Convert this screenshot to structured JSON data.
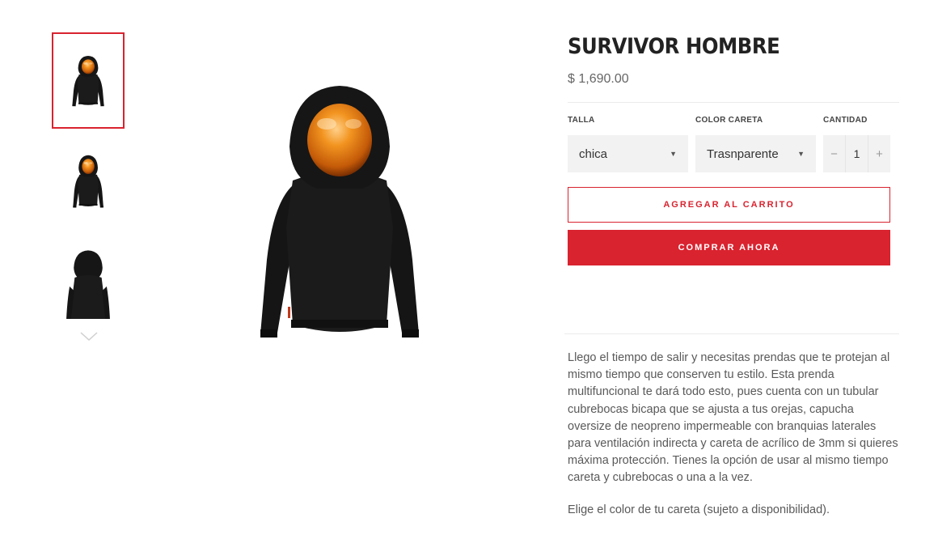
{
  "product": {
    "title": "SURVIVOR HOMBRE",
    "price": "$ 1,690.00",
    "description": "Llego el tiempo de salir y necesitas prendas que te protejan al mismo tiempo que conserven tu estilo. Esta prenda multifuncional te dará todo esto, pues cuenta con un tubular cubrebocas bicapa que se ajusta a tus orejas, capucha oversize de neopreno impermeable con branquias laterales para ventilación indirecta y careta de acrílico de 3mm si quieres máxima protección. Tienes la opción de usar al mismo tiempo careta y cubrebocas o una a la vez.",
    "note": "Elige el color de tu careta (sujeto a disponibilidad)."
  },
  "options": {
    "size_label": "TALLA",
    "size_value": "chica",
    "color_label": "COLOR CARETA",
    "color_value": "Trasnparente",
    "qty_label": "CANTIDAD",
    "qty_value": "1",
    "qty_minus": "−",
    "qty_plus": "+"
  },
  "buttons": {
    "add_to_cart": "AGREGAR AL CARRITO",
    "buy_now": "COMPRAR AHORA"
  },
  "gallery": {
    "thumbnails": [
      "front-view",
      "side-view",
      "back-view"
    ],
    "selected_index": 0
  },
  "icons": {
    "caret": "dropdown-caret-icon",
    "thumbnails_next": "chevron-down-icon"
  },
  "colors": {
    "accent": "#d9232f",
    "visor": "#f08a1c",
    "garment": "#1a1a1a"
  }
}
